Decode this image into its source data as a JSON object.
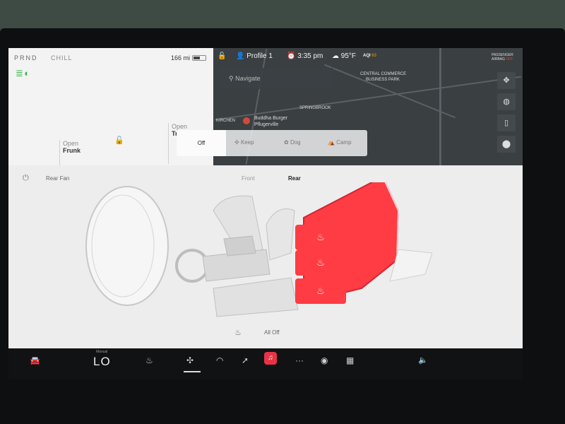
{
  "status": {
    "gear": "PRND",
    "drive_mode": "CHILL",
    "range": "166 mi",
    "battery_level": 0.55
  },
  "closures": {
    "frunk_action": "Open",
    "frunk_label": "Frunk",
    "trunk_action": "Open",
    "trunk_label": "Tr"
  },
  "topbar": {
    "profile": "Profile 1",
    "time": "3:35 pm",
    "temperature": "95°F",
    "aqi_label": "AQI",
    "aqi_value": "63",
    "airbag_line1": "PASSENGER",
    "airbag_line2": "AIRBAG",
    "airbag_status": "OFF"
  },
  "map": {
    "search_placeholder": "Navigate",
    "labels": [
      "Buddha Burger",
      "Pflugerville",
      "SPRINGBROOK",
      "KIRCHEN",
      "CENTRAL COMMERCE",
      "BUSINESS PARK"
    ]
  },
  "climate_modes": {
    "off": "Off",
    "keep": "Keep",
    "dog": "Dog",
    "camp": "Camp",
    "selected": "Off"
  },
  "climate": {
    "rear_fan_label": "Rear Fan",
    "tab_front": "Front",
    "tab_rear": "Rear",
    "active_tab": "Rear",
    "all_off_label": "All Off",
    "rear_seat_heat": [
      "heat-icon",
      "heat-icon",
      "heat-icon"
    ]
  },
  "dock": {
    "temp_caption": "Manual",
    "temp_value": "LO",
    "active_item": "fan"
  },
  "colors": {
    "heat": "#ff3c44",
    "screen_bg": "#ededee",
    "dock_bg": "#111213",
    "headlight": "#3bb54a"
  }
}
